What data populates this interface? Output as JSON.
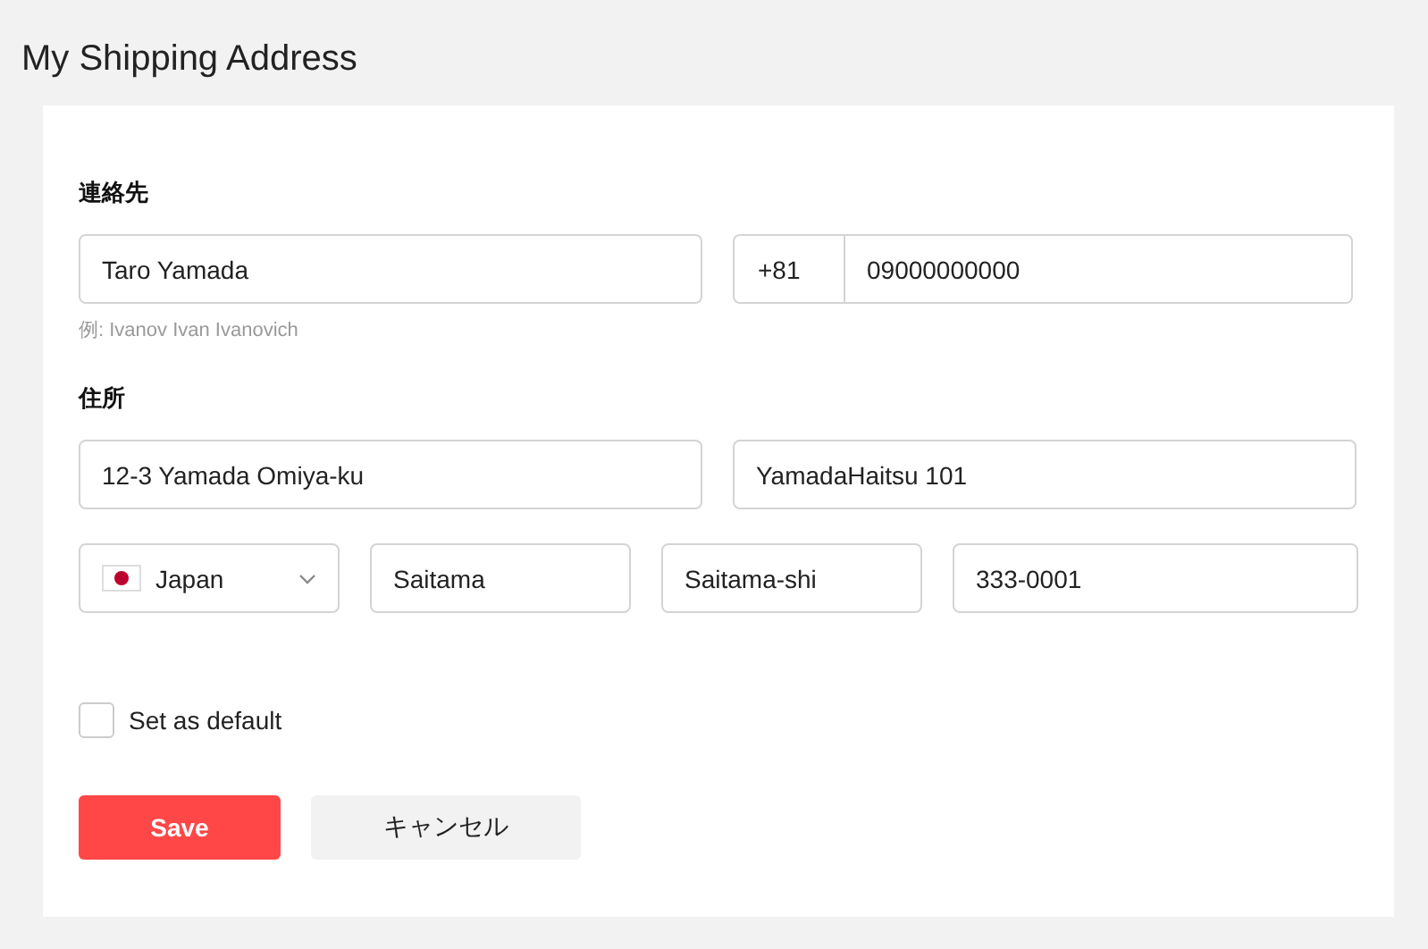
{
  "page_title": "My Shipping Address",
  "contact": {
    "label": "連絡先",
    "name_value": "Taro Yamada",
    "name_hint": "例: Ivanov Ivan Ivanovich",
    "phone_code": "+81",
    "phone_value": "09000000000"
  },
  "address": {
    "label": "住所",
    "street": "12-3 Yamada Omiya-ku",
    "building": "YamadaHaitsu 101",
    "country": "Japan",
    "prefecture": "Saitama",
    "city": "Saitama-shi",
    "postal_code": "333-0001"
  },
  "default_checkbox": {
    "label": "Set as default",
    "checked": false
  },
  "buttons": [
    {
      "kind": "primary",
      "label": "Save"
    },
    {
      "kind": "secondary",
      "label": "キャンセル"
    }
  ]
}
